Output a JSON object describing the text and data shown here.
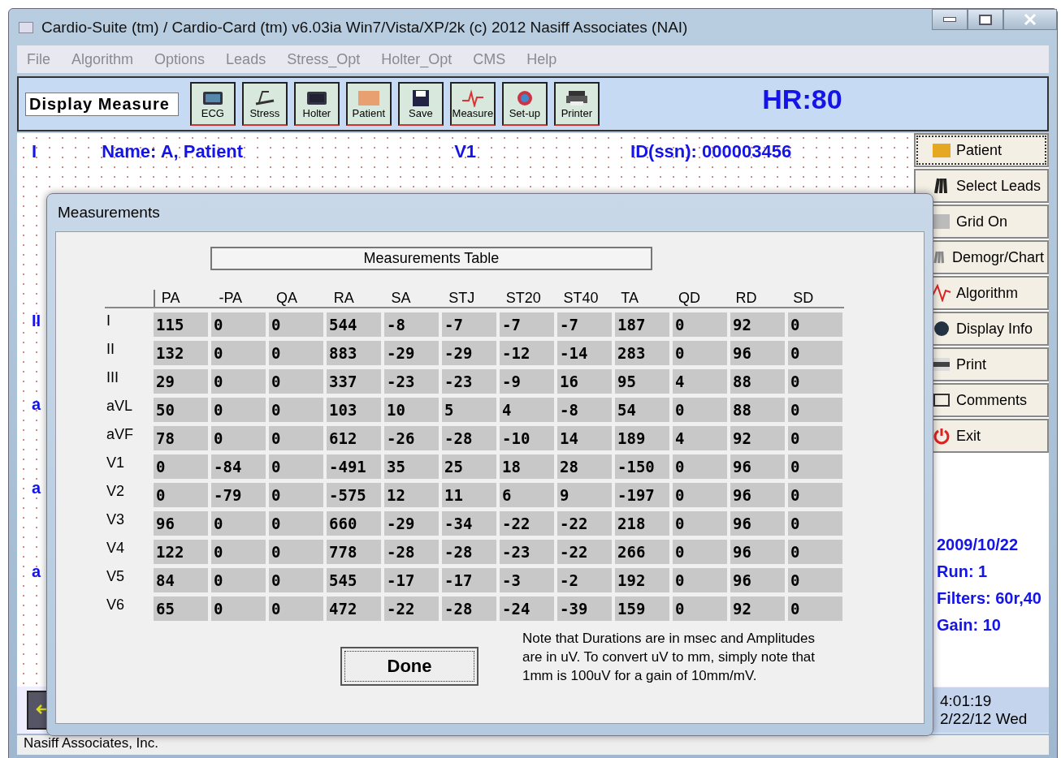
{
  "window": {
    "title": "Cardio-Suite (tm) / Cardio-Card (tm) v6.03ia Win7/Vista/XP/2k (c) 2012 Nasiff Associates (NAI)"
  },
  "menu": [
    "File",
    "Algorithm",
    "Options",
    "Leads",
    "Stress_Opt",
    "Holter_Opt",
    "CMS",
    "Help"
  ],
  "toolbar": {
    "mode": "Display Measure",
    "buttons": [
      "ECG",
      "Stress",
      "Holter",
      "Patient",
      "Save",
      "Measure",
      "Set-up",
      "Printer"
    ],
    "heart_rate": "HR:80"
  },
  "ecg": {
    "lead_first": "I",
    "name": "Name: A, Patient",
    "lead_second": "V1",
    "id": "ID(ssn): 000003456",
    "edge_labels": [
      "II",
      "a",
      "a",
      "a"
    ]
  },
  "sidebar": {
    "buttons": [
      "Patient",
      "Select Leads",
      "Grid On",
      "Demogr/Chart",
      "Algorithm",
      "Display Info",
      "Print",
      "Comments",
      "Exit"
    ],
    "info": [
      "2009/10/22",
      "Run: 1",
      "Filters: 60r,40",
      "Gain: 10"
    ],
    "clock": [
      "4:01:19",
      "2/22/12 Wed"
    ]
  },
  "status_bar": "Nasiff Associates, Inc.",
  "dialog": {
    "title": "Measurements",
    "table_title": "Measurements Table",
    "columns": [
      "PA",
      "-PA",
      "QA",
      "RA",
      "SA",
      "STJ",
      "ST20",
      "ST40",
      "TA",
      "QD",
      "RD",
      "SD"
    ],
    "rows": [
      {
        "lead": "I",
        "values": [
          "115",
          "0",
          "0",
          "544",
          "-8",
          "-7",
          "-7",
          "-7",
          "187",
          "0",
          "92",
          "0"
        ]
      },
      {
        "lead": "II",
        "values": [
          "132",
          "0",
          "0",
          "883",
          "-29",
          "-29",
          "-12",
          "-14",
          "283",
          "0",
          "96",
          "0"
        ]
      },
      {
        "lead": "III",
        "values": [
          "29",
          "0",
          "0",
          "337",
          "-23",
          "-23",
          "-9",
          "16",
          "95",
          "4",
          "88",
          "0"
        ]
      },
      {
        "lead": "aVL",
        "values": [
          "50",
          "0",
          "0",
          "103",
          "10",
          "5",
          "4",
          "-8",
          "54",
          "0",
          "88",
          "0"
        ]
      },
      {
        "lead": "aVF",
        "values": [
          "78",
          "0",
          "0",
          "612",
          "-26",
          "-28",
          "-10",
          "14",
          "189",
          "4",
          "92",
          "0"
        ]
      },
      {
        "lead": "V1",
        "values": [
          "0",
          "-84",
          "0",
          "-491",
          "35",
          "25",
          "18",
          "28",
          "-150",
          "0",
          "96",
          "0"
        ]
      },
      {
        "lead": "V2",
        "values": [
          "0",
          "-79",
          "0",
          "-575",
          "12",
          "11",
          "6",
          "9",
          "-197",
          "0",
          "96",
          "0"
        ]
      },
      {
        "lead": "V3",
        "values": [
          "96",
          "0",
          "0",
          "660",
          "-29",
          "-34",
          "-22",
          "-22",
          "218",
          "0",
          "96",
          "0"
        ]
      },
      {
        "lead": "V4",
        "values": [
          "122",
          "0",
          "0",
          "778",
          "-28",
          "-28",
          "-23",
          "-22",
          "266",
          "0",
          "96",
          "0"
        ]
      },
      {
        "lead": "V5",
        "values": [
          "84",
          "0",
          "0",
          "545",
          "-17",
          "-17",
          "-3",
          "-2",
          "192",
          "0",
          "96",
          "0"
        ]
      },
      {
        "lead": "V6",
        "values": [
          "65",
          "0",
          "0",
          "472",
          "-22",
          "-28",
          "-24",
          "-39",
          "159",
          "0",
          "92",
          "0"
        ]
      }
    ],
    "done": "Done",
    "note": "Note that Durations are in msec and Amplitudes are in uV. To convert uV to mm, simply note that 1mm is 100uV for a gain of 10mm/mV."
  }
}
